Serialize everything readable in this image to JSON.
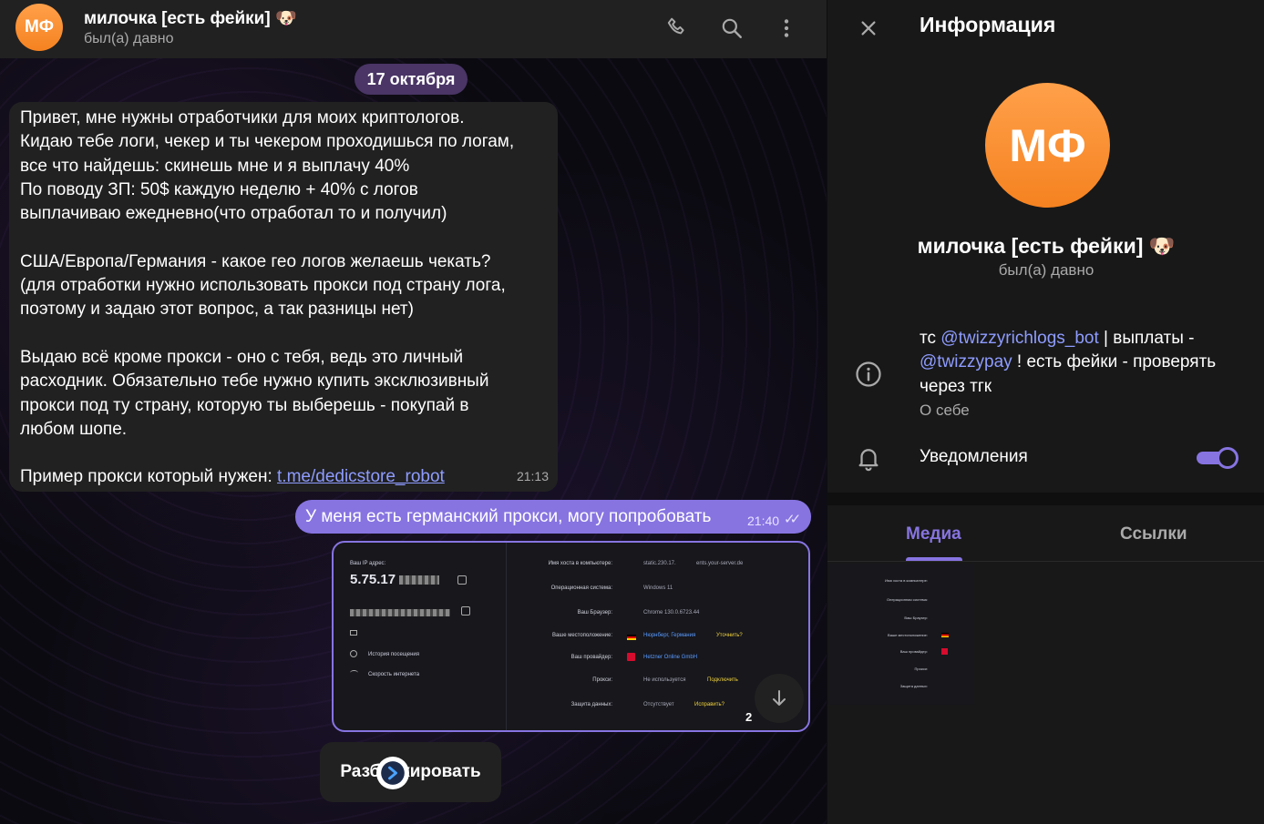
{
  "header": {
    "avatar_initials": "МФ",
    "name": "милочка [есть фейки] 🐶",
    "status": "был(а) давно",
    "icons": [
      "phone-icon",
      "search-icon",
      "more-vertical-icon"
    ]
  },
  "chat": {
    "date_separator": "17 октября",
    "incoming": {
      "lines": [
        "Привет, мне нужны отработчики для моих криптологов.",
        "Кидаю тебе логи, чекер и ты чекером проходишься по логам,",
        "все что найдешь: скинешь мне и я выплачу 40%",
        "По поводу ЗП: 50$ каждую неделю + 40% с логов",
        "выплачиваю ежедневно(что отработал то и получил)",
        "",
        "США/Европа/Германия - какое гео логов желаешь чекать?",
        "(для отработки нужно использовать прокси под страну лога,",
        "поэтому и задаю этот вопрос,  а так разницы нет)",
        "",
        "Выдаю всё кроме прокси - оно с тебя, ведь это личный",
        "расходник. Обязательно тебе нужно купить эксклюзивный",
        "прокси под ту страну, которую ты выберешь - покупай в",
        "любом шопе.",
        ""
      ],
      "last_line_prefix": "Пример прокси который нужен: ",
      "link": "t.me/dedicstore_robot",
      "time": "21:13"
    },
    "outgoing": {
      "text": "У меня есть германский прокси, могу попробовать",
      "time": "21:40",
      "checks": "✓✓"
    },
    "screenshot": {
      "left": {
        "ip_label": "Ваш IP адрес:",
        "ip_value": "5.75.17",
        "history": "История посещения",
        "speed": "Скорость интернета"
      },
      "rows": [
        {
          "label": "Имя хоста в компьютере:",
          "value": "static.230.17.",
          "extra": "ents.your-server.de"
        },
        {
          "label": "Операционная система:",
          "value": "Windows 11",
          "extra": ""
        },
        {
          "label": "Ваш Браузер:",
          "value": "Chrome 130.0.6723.44",
          "extra": ""
        },
        {
          "label": "Ваше местоположение:",
          "value": "Нюрнберг, Германия",
          "extra": "Уточнить?"
        },
        {
          "label": "Ваш провайдер:",
          "value": "Hetzner Online GmbH",
          "extra": ""
        },
        {
          "label": "Прокси:",
          "value": "Не используется",
          "extra": "Подключить"
        },
        {
          "label": "Защита данных:",
          "value": "Отсутствует",
          "extra": "Исправить?"
        }
      ],
      "time_partial": "2"
    },
    "unblock_button": "Разблокировать",
    "colors": {
      "accent": "#8774e1",
      "link": "#8e9cff",
      "avatar": "#f58220",
      "date_pill": "#4a3566"
    }
  },
  "panel": {
    "title": "Информация",
    "avatar_initials": "МФ",
    "name": "милочка [есть фейки] 🐶",
    "status": "был(а) давно",
    "bio": {
      "prefix": "тс ",
      "mention1": "@twizzyrichlogs_bot",
      "middle": " | выплаты - ",
      "mention2": "@twizzypay",
      "suffix": " ! есть фейки - проверять через тгк"
    },
    "bio_label": "О себе",
    "notifications_label": "Уведомления",
    "notifications_on": true,
    "tabs": [
      "Медиа",
      "Ссылки"
    ]
  }
}
